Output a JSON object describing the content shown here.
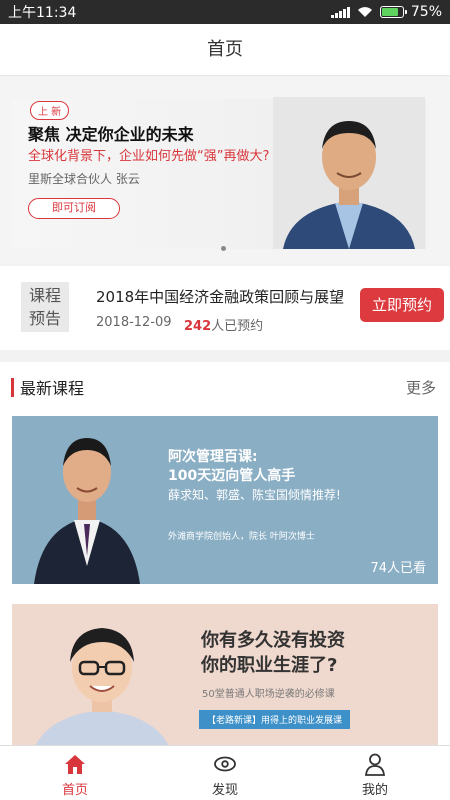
{
  "status": {
    "time": "上午11:34",
    "battery": "75%",
    "battery_level": 0.75
  },
  "header": {
    "title": "首页"
  },
  "banner": {
    "tag": "上 新",
    "title": "聚焦 决定你企业的未来",
    "subtitle": "全球化背景下，企业如何先做“强”再做大?",
    "author": "里斯全球合伙人  张云",
    "button": "即可订阅"
  },
  "preview": {
    "badge_line1": "课程",
    "badge_line2": "预告",
    "title": "2018年中国经济金融政策回顾与展望",
    "date": "2018-12-09",
    "count": "242",
    "count_suffix": "人已预约",
    "button": "立即预约"
  },
  "section": {
    "title": "最新课程",
    "more": "更多"
  },
  "courses": [
    {
      "head1": "阿次管理百课:",
      "head2": "100天迈向管人高手",
      "recommend": "薛求知、郭盛、陈宝国倾情推荐!",
      "by": "外滩商学院创始人，院长 叶阿次博士",
      "watch": "74人已看"
    },
    {
      "head1": "你有多久没有投资",
      "head2": "你的职业生涯了?",
      "sub": "50堂普通人职场逆袭的必修课",
      "pill": "【老路新课】用得上的职业发展课"
    }
  ],
  "tabs": [
    {
      "label": "首页",
      "icon": "home-icon",
      "active": true
    },
    {
      "label": "发现",
      "icon": "eye-icon",
      "active": false
    },
    {
      "label": "我的",
      "icon": "person-icon",
      "active": false
    }
  ],
  "colors": {
    "accent": "#d9363b",
    "card1_bg": "#8aaec4",
    "card2_bg": "#efd8cd"
  }
}
